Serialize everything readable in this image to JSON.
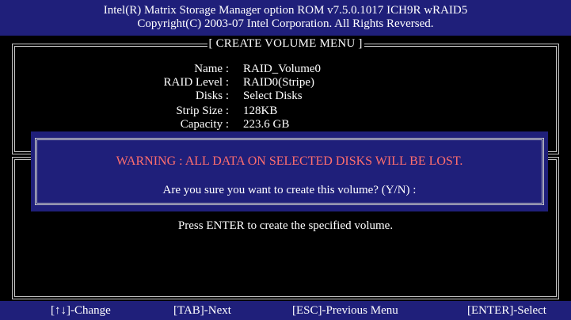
{
  "header": {
    "line1": "Intel(R) Matrix Storage Manager option ROM v7.5.0.1017 ICH9R wRAID5",
    "line2": "Copyright(C) 2003-07 Intel Corporation.  All Rights Reversed."
  },
  "create_menu": {
    "title": "[ CREATE VOLUME MENU ]",
    "fields": [
      {
        "label": "Name :",
        "value": "RAID_Volume0"
      },
      {
        "label": "RAID Level :",
        "value": "RAID0(Stripe)"
      },
      {
        "label": "Disks :",
        "value": "Select Disks"
      },
      {
        "label": "Strip Size :",
        "value": "128KB"
      },
      {
        "label": "Capacity :",
        "value": "223.6  GB"
      }
    ]
  },
  "help_panel": {
    "instruction": "Press ENTER to create the specified volume."
  },
  "dialog": {
    "warning": "WARNING : ALL DATA ON SELECTED DISKS WILL BE LOST.",
    "prompt": "Are you sure you want to create this volume? (Y/N) :"
  },
  "footer": {
    "change": "[↑↓]-Change",
    "next": "[TAB]-Next",
    "previous": "[ESC]-Previous Menu",
    "select": "[ENTER]-Select"
  },
  "colors": {
    "bar_blue": "#1f1f7a",
    "warning_red": "#ff6e6e",
    "border_gray": "#c8c8c8"
  }
}
